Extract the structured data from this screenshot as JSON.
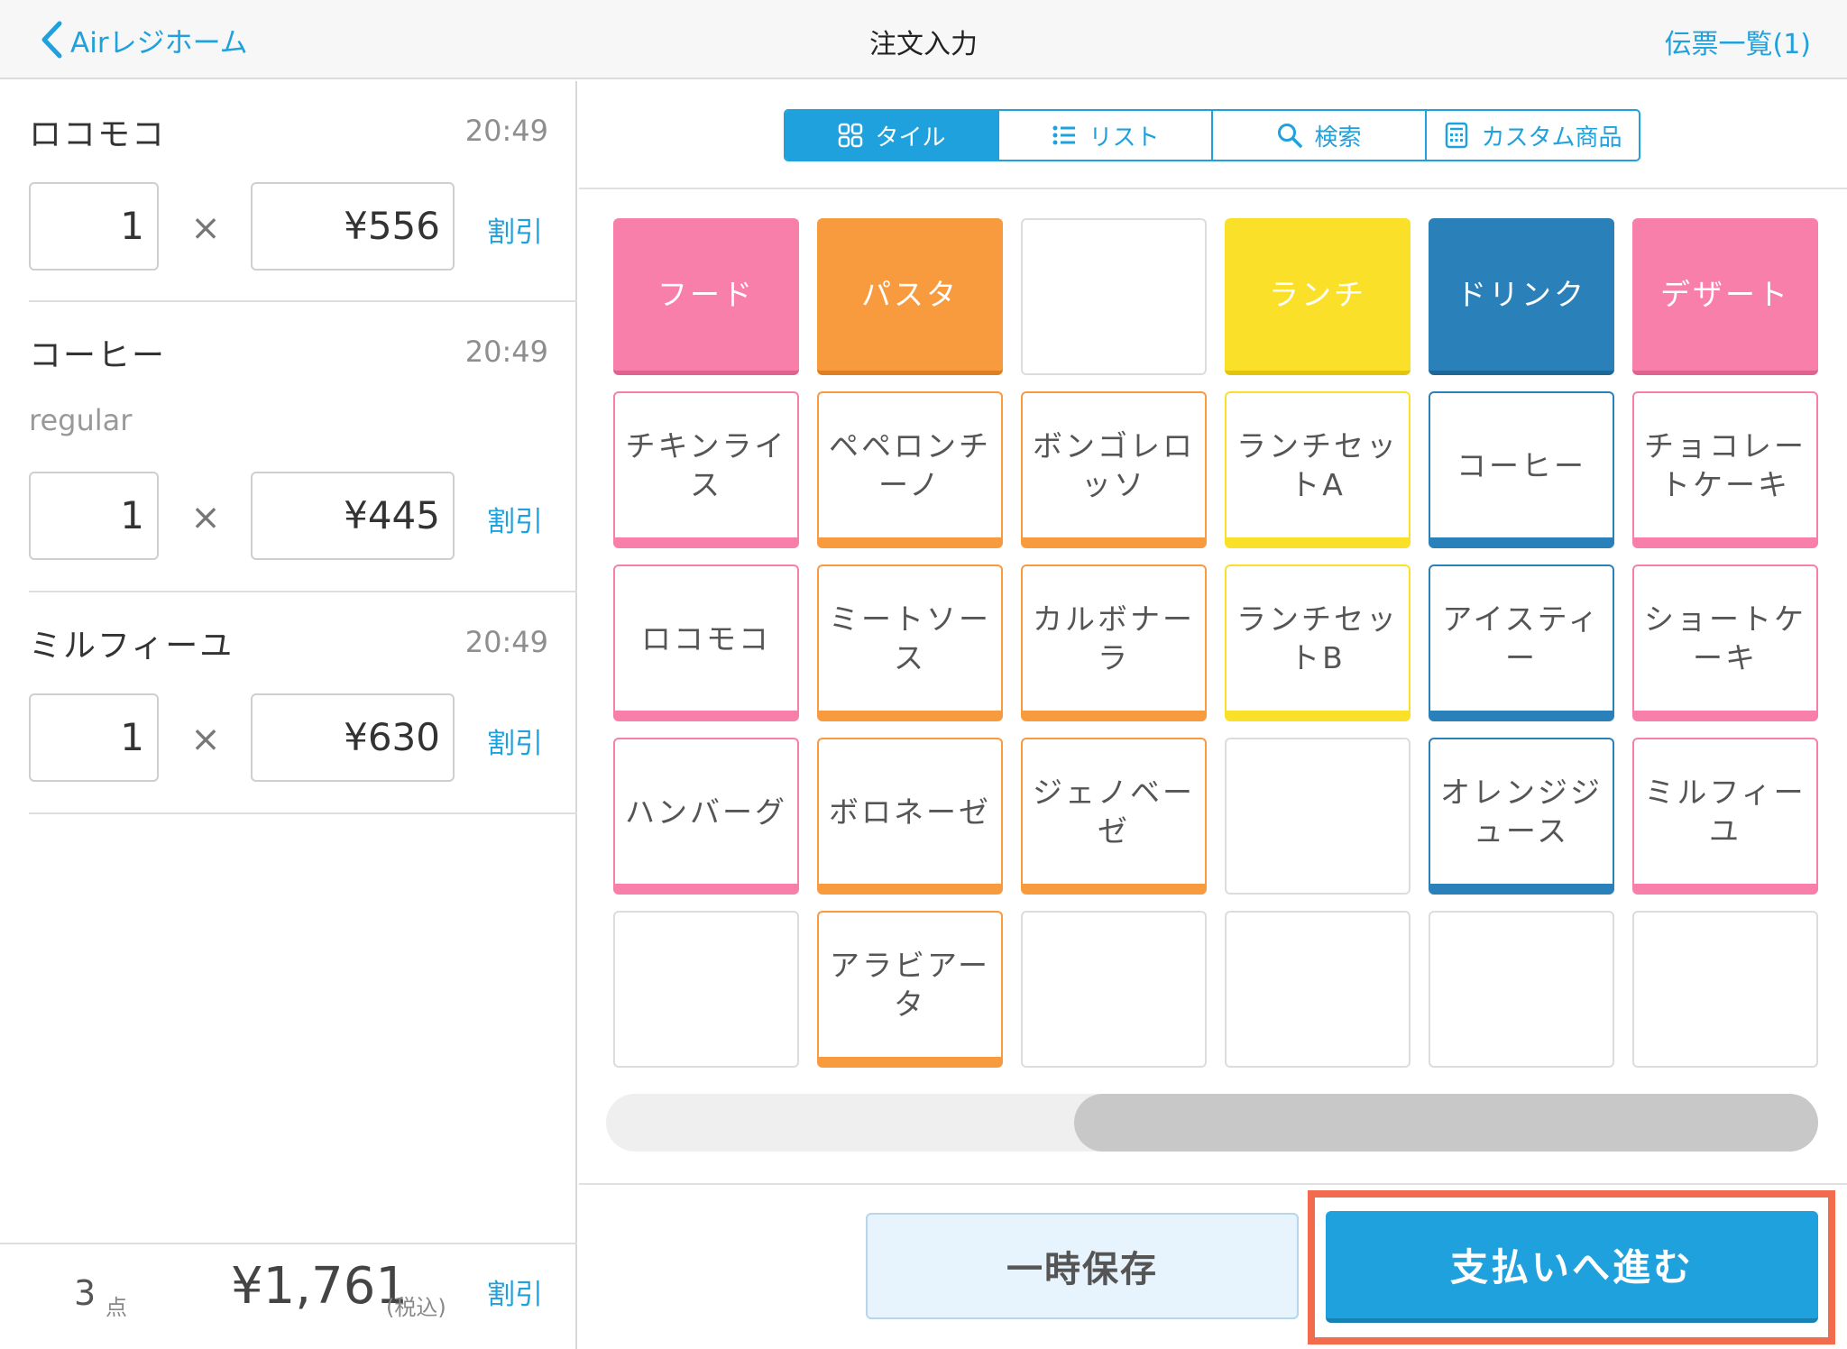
{
  "header": {
    "back_label": "Airレジホーム",
    "title": "注文入力",
    "slip_list_label": "伝票一覧(1)"
  },
  "order_items": [
    {
      "name": "ロコモコ",
      "time": "20:49",
      "option": "",
      "quantity": "1",
      "times": "×",
      "price": "¥556",
      "discount_label": "割引"
    },
    {
      "name": "コーヒー",
      "time": "20:49",
      "option": "regular",
      "quantity": "1",
      "times": "×",
      "price": "¥445",
      "discount_label": "割引"
    },
    {
      "name": "ミルフィーユ",
      "time": "20:49",
      "option": "",
      "quantity": "1",
      "times": "×",
      "price": "¥630",
      "discount_label": "割引"
    }
  ],
  "footer": {
    "count": "3",
    "count_unit": "点",
    "total": "¥1,761",
    "tax_note": "(税込)",
    "discount_label": "割引"
  },
  "view_tabs": [
    {
      "label": "タイル",
      "icon": "grid-icon",
      "active": true
    },
    {
      "label": "リスト",
      "icon": "list-icon",
      "active": false
    },
    {
      "label": "検索",
      "icon": "search-icon",
      "active": false
    },
    {
      "label": "カスタム商品",
      "icon": "calculator-icon",
      "active": false
    }
  ],
  "colors": {
    "accent": "#1ea1dc",
    "food": "#f97fab",
    "pasta": "#f89b3e",
    "lunch": "#fbe02a",
    "drink": "#2a80b9",
    "dessert": "#f97fab",
    "highlight": "#f26b4f"
  },
  "tile_rows": [
    [
      {
        "type": "category",
        "label": "フード",
        "color": "food"
      },
      {
        "type": "category",
        "label": "パスタ",
        "color": "pasta"
      },
      {
        "type": "empty"
      },
      {
        "type": "category",
        "label": "ランチ",
        "color": "lunch"
      },
      {
        "type": "category",
        "label": "ドリンク",
        "color": "drink"
      },
      {
        "type": "category",
        "label": "デザート",
        "color": "dessert"
      }
    ],
    [
      {
        "type": "product",
        "label": "チキンライス",
        "color": "food"
      },
      {
        "type": "product",
        "label": "ペペロンチーノ",
        "color": "pasta"
      },
      {
        "type": "product",
        "label": "ボンゴレロッソ",
        "color": "pasta"
      },
      {
        "type": "product",
        "label": "ランチセットA",
        "color": "lunch"
      },
      {
        "type": "product",
        "label": "コーヒー",
        "color": "drink"
      },
      {
        "type": "product",
        "label": "チョコレートケーキ",
        "color": "dessert"
      }
    ],
    [
      {
        "type": "product",
        "label": "ロコモコ",
        "color": "food"
      },
      {
        "type": "product",
        "label": "ミートソース",
        "color": "pasta"
      },
      {
        "type": "product",
        "label": "カルボナーラ",
        "color": "pasta"
      },
      {
        "type": "product",
        "label": "ランチセットB",
        "color": "lunch"
      },
      {
        "type": "product",
        "label": "アイスティー",
        "color": "drink"
      },
      {
        "type": "product",
        "label": "ショートケーキ",
        "color": "dessert"
      }
    ],
    [
      {
        "type": "product",
        "label": "ハンバーグ",
        "color": "food"
      },
      {
        "type": "product",
        "label": "ボロネーゼ",
        "color": "pasta"
      },
      {
        "type": "product",
        "label": "ジェノベーゼ",
        "color": "pasta"
      },
      {
        "type": "empty"
      },
      {
        "type": "product",
        "label": "オレンジジュース",
        "color": "drink"
      },
      {
        "type": "product",
        "label": "ミルフィーユ",
        "color": "dessert"
      }
    ],
    [
      {
        "type": "empty"
      },
      {
        "type": "product",
        "label": "アラビアータ",
        "color": "pasta"
      },
      {
        "type": "empty"
      },
      {
        "type": "empty"
      },
      {
        "type": "empty"
      },
      {
        "type": "empty"
      }
    ]
  ],
  "scroll": {
    "position": 0.6
  },
  "actions": {
    "hold_label": "一時保存",
    "pay_label": "支払いへ進む"
  }
}
